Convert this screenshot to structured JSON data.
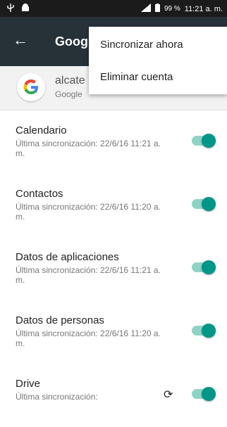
{
  "status_bar": {
    "battery": "99 %",
    "time": "11:21 a. m."
  },
  "toolbar": {
    "title": "Goog",
    "back_icon": "arrow-left-icon"
  },
  "account": {
    "name": "alcate",
    "type": "Google",
    "logo": "google-logo"
  },
  "sync_items": [
    {
      "title": "Calendario",
      "subtitle": "Última sincronización: 22/6/16 11:21 a. m.",
      "enabled": true
    },
    {
      "title": "Contactos",
      "subtitle": "Última sincronización: 22/6/16 11:20 a. m.",
      "enabled": true
    },
    {
      "title": "Datos de aplicaciones",
      "subtitle": "Última sincronización: 22/6/16 11:21 a. m.",
      "enabled": true
    },
    {
      "title": "Datos de personas",
      "subtitle": "Última sincronización: 22/6/16 11:20 a. m.",
      "enabled": true
    },
    {
      "title": "Drive",
      "subtitle": "Última sincronización:",
      "enabled": true
    }
  ],
  "menu": {
    "items": [
      "Sincronizar ahora",
      "Eliminar cuenta"
    ]
  },
  "colors": {
    "toolbar": "#263238",
    "accent": "#009688",
    "track": "#8fd3c6"
  }
}
